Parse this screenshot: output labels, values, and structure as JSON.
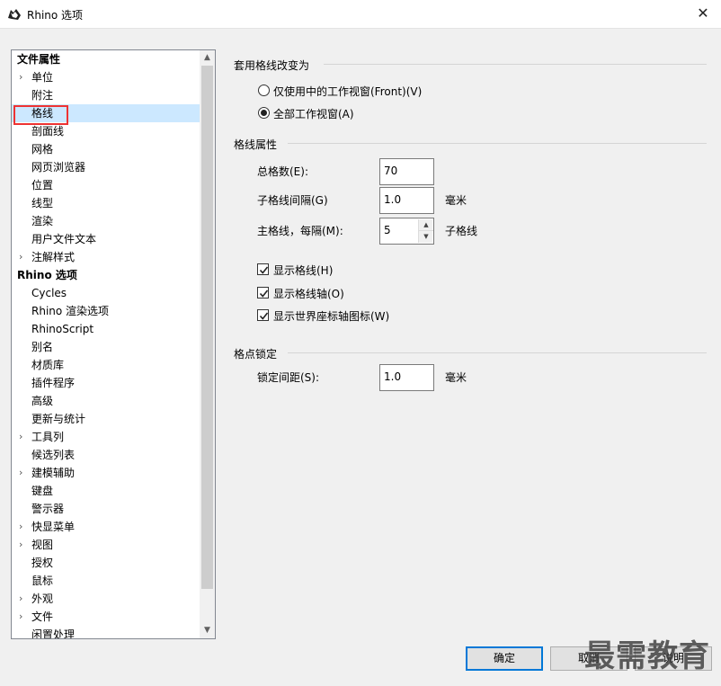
{
  "window": {
    "title": "Rhino 选项",
    "close_glyph": "✕"
  },
  "tree": {
    "items": [
      {
        "label": "文件属性",
        "bold": true,
        "indent": 0,
        "expander": false
      },
      {
        "label": "单位",
        "bold": false,
        "indent": 1,
        "expander": true
      },
      {
        "label": "附注",
        "bold": false,
        "indent": 1,
        "expander": false
      },
      {
        "label": "格线",
        "bold": false,
        "indent": 1,
        "expander": false,
        "selected": true
      },
      {
        "label": "剖面线",
        "bold": false,
        "indent": 1,
        "expander": false
      },
      {
        "label": "网格",
        "bold": false,
        "indent": 1,
        "expander": false
      },
      {
        "label": "网页浏览器",
        "bold": false,
        "indent": 1,
        "expander": false
      },
      {
        "label": "位置",
        "bold": false,
        "indent": 1,
        "expander": false
      },
      {
        "label": "线型",
        "bold": false,
        "indent": 1,
        "expander": false
      },
      {
        "label": "渲染",
        "bold": false,
        "indent": 1,
        "expander": false
      },
      {
        "label": "用户文件文本",
        "bold": false,
        "indent": 1,
        "expander": false
      },
      {
        "label": "注解样式",
        "bold": false,
        "indent": 1,
        "expander": true
      },
      {
        "label": "Rhino 选项",
        "bold": true,
        "indent": 0,
        "expander": false
      },
      {
        "label": "Cycles",
        "bold": false,
        "indent": 1,
        "expander": false
      },
      {
        "label": "Rhino 渲染选项",
        "bold": false,
        "indent": 1,
        "expander": false
      },
      {
        "label": "RhinoScript",
        "bold": false,
        "indent": 1,
        "expander": false
      },
      {
        "label": "别名",
        "bold": false,
        "indent": 1,
        "expander": false
      },
      {
        "label": "材质库",
        "bold": false,
        "indent": 1,
        "expander": false
      },
      {
        "label": "插件程序",
        "bold": false,
        "indent": 1,
        "expander": false
      },
      {
        "label": "高级",
        "bold": false,
        "indent": 1,
        "expander": false
      },
      {
        "label": "更新与统计",
        "bold": false,
        "indent": 1,
        "expander": false
      },
      {
        "label": "工具列",
        "bold": false,
        "indent": 1,
        "expander": true
      },
      {
        "label": "候选列表",
        "bold": false,
        "indent": 1,
        "expander": false
      },
      {
        "label": "建模辅助",
        "bold": false,
        "indent": 1,
        "expander": true
      },
      {
        "label": "键盘",
        "bold": false,
        "indent": 1,
        "expander": false
      },
      {
        "label": "警示器",
        "bold": false,
        "indent": 1,
        "expander": false
      },
      {
        "label": "快显菜单",
        "bold": false,
        "indent": 1,
        "expander": true
      },
      {
        "label": "视图",
        "bold": false,
        "indent": 1,
        "expander": true
      },
      {
        "label": "授权",
        "bold": false,
        "indent": 1,
        "expander": false
      },
      {
        "label": "鼠标",
        "bold": false,
        "indent": 1,
        "expander": false
      },
      {
        "label": "外观",
        "bold": false,
        "indent": 1,
        "expander": true
      },
      {
        "label": "文件",
        "bold": false,
        "indent": 1,
        "expander": true
      },
      {
        "label": "闲置处理",
        "bold": false,
        "indent": 1,
        "expander": false
      }
    ]
  },
  "apply_grid": {
    "title": "套用格线改变为",
    "option_active": "仅使用中的工作视窗(Front)(V)",
    "option_all": "全部工作视窗(A)",
    "selected": "all"
  },
  "grid_props": {
    "title": "格线属性",
    "total_label": "总格数(E):",
    "total_value": "70",
    "minor_label": "子格线间隔(G)",
    "minor_value": "1.0",
    "minor_unit": "毫米",
    "major_label": "主格线，每隔(M):",
    "major_value": "5",
    "major_unit": "子格线",
    "show_grid": "显示格线(H)",
    "show_grid_axes": "显示格线轴(O)",
    "show_world_axes": "显示世界座标轴图标(W)"
  },
  "snap": {
    "title": "格点锁定",
    "spacing_label": "锁定间距(S):",
    "spacing_value": "1.0",
    "spacing_unit": "毫米"
  },
  "buttons": {
    "ok": "确定",
    "cancel": "取消",
    "help": "说明"
  },
  "watermark": "最需教育"
}
